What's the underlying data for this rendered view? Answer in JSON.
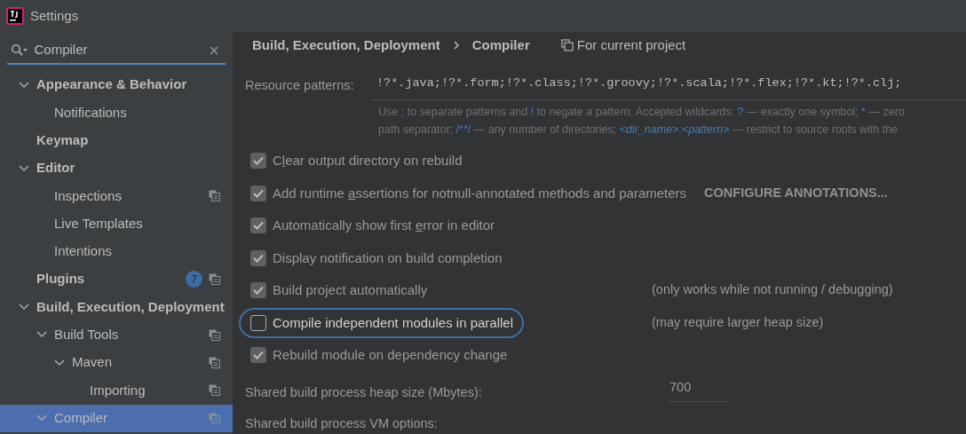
{
  "window": {
    "title": "Settings"
  },
  "search": {
    "value": "Compiler"
  },
  "tree": [
    {
      "label": "Appearance & Behavior",
      "bold": true,
      "expanded": true,
      "selected": false,
      "children": [
        {
          "label": "Notifications",
          "selected": false
        }
      ]
    },
    {
      "label": "Keymap",
      "bold": true,
      "selected": false
    },
    {
      "label": "Editor",
      "bold": true,
      "expanded": true,
      "selected": false,
      "children": [
        {
          "label": "Inspections",
          "project": true,
          "selected": false
        },
        {
          "label": "Live Templates",
          "selected": false
        },
        {
          "label": "Intentions",
          "selected": false
        }
      ]
    },
    {
      "label": "Plugins",
      "bold": true,
      "badge": "7",
      "project": true,
      "selected": false
    },
    {
      "label": "Build, Execution, Deployment",
      "bold": true,
      "expanded": true,
      "selected": false,
      "children": [
        {
          "label": "Build Tools",
          "expanded": true,
          "project": true,
          "selected": false,
          "children": [
            {
              "label": "Maven",
              "expanded": true,
              "project": true,
              "selected": false,
              "children": [
                {
                  "label": "Importing",
                  "project": true,
                  "selected": false
                }
              ]
            }
          ]
        },
        {
          "label": "Compiler",
          "expanded": true,
          "project": true,
          "selected": true
        }
      ]
    }
  ],
  "breadcrumb": [
    "Build, Execution, Deployment",
    "Compiler"
  ],
  "scope": "For current project",
  "resource_patterns": {
    "label": "Resource patterns:",
    "value": "!?*.java;!?*.form;!?*.class;!?*.groovy;!?*.scala;!?*.flex;!?*.kt;!?*.clj;"
  },
  "hint_lines": [
    [
      {
        "kind": "plain",
        "text": "Use "
      },
      {
        "kind": "token",
        "text": ";"
      },
      {
        "kind": "plain",
        "text": " to separate patterns and "
      },
      {
        "kind": "token",
        "text": "!"
      },
      {
        "kind": "plain",
        "text": " to negate a pattern. Accepted wildcards: "
      },
      {
        "kind": "token",
        "text": "?"
      },
      {
        "kind": "plain",
        "text": " — exactly one symbol; "
      },
      {
        "kind": "token",
        "text": "*"
      },
      {
        "kind": "plain",
        "text": " — zero"
      }
    ],
    [
      {
        "kind": "plain",
        "text": "path separator; "
      },
      {
        "kind": "token",
        "text": "/**/"
      },
      {
        "kind": "plain",
        "text": " — any number of directories; "
      },
      {
        "kind": "italic",
        "text": "<dir_name>"
      },
      {
        "kind": "plain",
        "text": ":"
      },
      {
        "kind": "italic",
        "text": "<pattern>"
      },
      {
        "kind": "plain",
        "text": " — restrict to source roots with the"
      }
    ]
  ],
  "options": [
    {
      "label_before": "C",
      "mnemonic": "l",
      "label_after": "ear output directory on rebuild",
      "checked": true,
      "highlighted": false
    },
    {
      "label_before": "Add runtime ",
      "mnemonic": "a",
      "label_after": "ssertions for notnull-annotated methods and parameters",
      "checked": true,
      "highlighted": false,
      "action": "CONFIGURE ANNOTATIONS..."
    },
    {
      "label_before": "Automatically show first ",
      "mnemonic": "e",
      "label_after": "rror in editor",
      "checked": true,
      "highlighted": false
    },
    {
      "label_before": "Display notification on build completion",
      "checked": true,
      "highlighted": false
    },
    {
      "label_before": "Build project automatically",
      "checked": true,
      "highlighted": false,
      "note": "(only works while not running / debugging)"
    },
    {
      "label_before": "Compile independent modules in parallel",
      "checked": false,
      "highlighted": true,
      "note": "(may require larger heap size)"
    },
    {
      "label_before": "Rebuild module on dependency change",
      "checked": true,
      "highlighted": false
    }
  ],
  "heap": {
    "label": "Shared build process heap size (Mbytes):",
    "value": "700"
  },
  "vm_options": {
    "label": "Shared build process VM options:"
  }
}
